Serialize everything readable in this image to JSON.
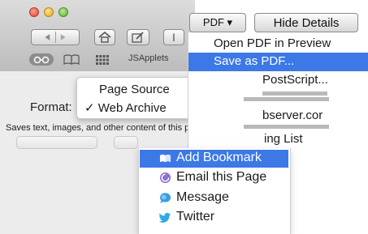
{
  "window": {
    "toolbar_text": "JSApplets",
    "edit_button_glyph": "I"
  },
  "toolbar": {
    "pdf_label": "PDF ▾",
    "hide_details_label": "Hide Details"
  },
  "pdf_menu": {
    "items": [
      {
        "label": "Open PDF in Preview"
      },
      {
        "label": "Save as PDF...",
        "selected": true
      },
      {
        "label": "PostScript..."
      }
    ],
    "partial_items": [
      "bserver.cor",
      "ing List"
    ]
  },
  "format_section": {
    "label": "Format:",
    "description": "Saves text, images, and other content of this page."
  },
  "format_menu": {
    "items": [
      {
        "label": "Page Source",
        "checked": false
      },
      {
        "label": "Web Archive",
        "checked": true
      }
    ],
    "check_glyph": "✓"
  },
  "share_menu": {
    "items": [
      {
        "label": "Add Bookmark",
        "icon": "book-icon",
        "selected": true
      },
      {
        "label": "Email this Page",
        "icon": "mail-icon"
      },
      {
        "label": "Message",
        "icon": "message-icon"
      },
      {
        "label": "Twitter",
        "icon": "twitter-icon"
      }
    ]
  },
  "colors": {
    "highlight": "#3c78e6",
    "traffic_red": "#e2463a",
    "traffic_yellow": "#e5a51d",
    "traffic_green": "#5eae32"
  }
}
